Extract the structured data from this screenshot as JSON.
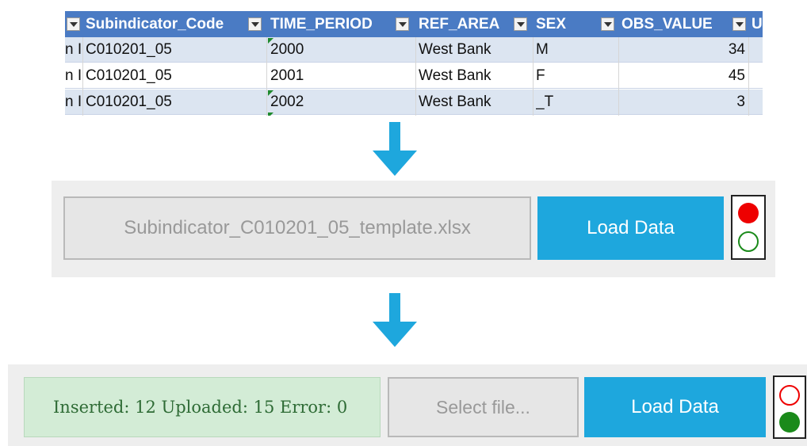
{
  "sheet": {
    "headers": [
      {
        "key": "prev",
        "label": ""
      },
      {
        "key": "sub",
        "label": "Subindicator_Code"
      },
      {
        "key": "time",
        "label": "TIME_PERIOD"
      },
      {
        "key": "ref",
        "label": "REF_AREA"
      },
      {
        "key": "sex",
        "label": "SEX"
      },
      {
        "key": "obs",
        "label": "OBS_VALUE"
      },
      {
        "key": "next",
        "label": "U"
      }
    ],
    "rows": [
      {
        "prev": "n I",
        "sub": "C010201_05",
        "time": "2000",
        "ref": "West Bank",
        "sex": "M",
        "obs": "34"
      },
      {
        "prev": "n I",
        "sub": "C010201_05",
        "time": "2001",
        "ref": "West Bank",
        "sex": "F",
        "obs": "45"
      },
      {
        "prev": "n I",
        "sub": "C010201_05",
        "time": "2002",
        "ref": "West Bank",
        "sex": "_T",
        "obs": "3"
      }
    ]
  },
  "panel1": {
    "file_name": "Subindicator_C010201_05_template.xlsx",
    "load_label": "Load Data",
    "status": {
      "red": "on",
      "green": "off"
    }
  },
  "panel2": {
    "message": "Inserted: 12 Uploaded: 15 Error: 0",
    "file_placeholder": "Select file...",
    "load_label": "Load Data",
    "status": {
      "red": "off",
      "green": "on"
    }
  },
  "colors": {
    "header_blue": "#4a7bc4",
    "row_alt": "#dce5f1",
    "arrow_blue": "#1ea7dd",
    "button_blue": "#1ea7dd",
    "light_red": "#ee0000",
    "light_green": "#1a8a1a",
    "success_bg": "#d3ecd6",
    "success_text": "#2e6b35"
  },
  "icons": {
    "arrow": "arrow-down-icon",
    "filter": "filter-dropdown-icon",
    "status": "traffic-light-icon"
  }
}
